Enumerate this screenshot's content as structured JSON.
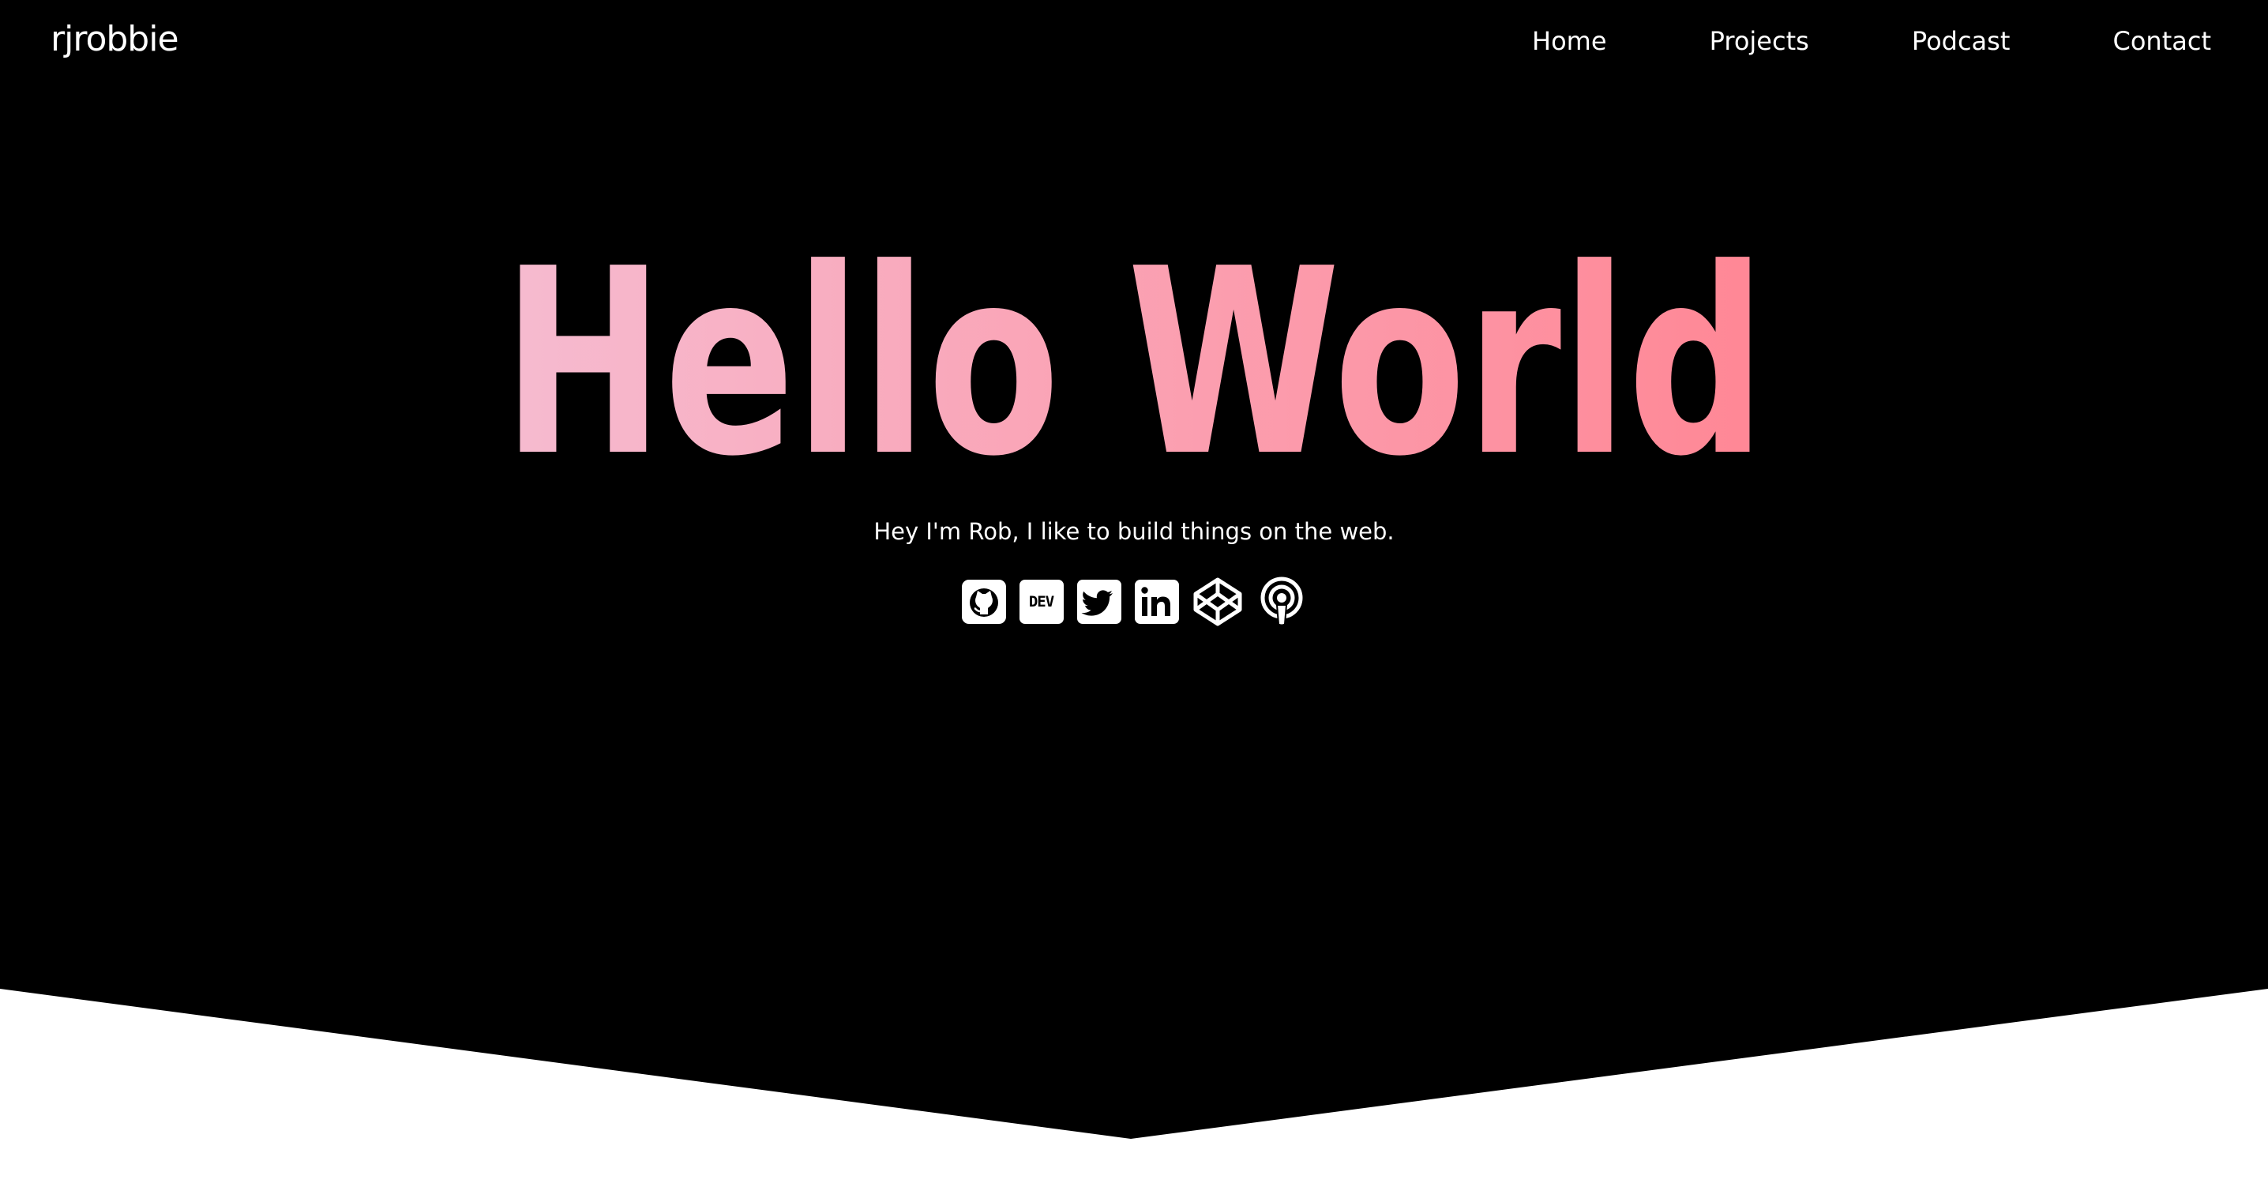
{
  "brand": {
    "name": "rjrobbie"
  },
  "nav": {
    "items": [
      {
        "label": "Home"
      },
      {
        "label": "Projects"
      },
      {
        "label": "Podcast"
      },
      {
        "label": "Contact"
      }
    ]
  },
  "hero": {
    "title": "Hello World",
    "tagline": "Hey I'm Rob, I like to build things on the web.",
    "gradient": {
      "start": "#F6BBD0",
      "end": "#FF8795"
    }
  },
  "social_links": [
    {
      "icon": "github-icon"
    },
    {
      "icon": "dev-icon",
      "text": "DEV"
    },
    {
      "icon": "twitter-icon"
    },
    {
      "icon": "linkedin-icon"
    },
    {
      "icon": "codepen-icon"
    },
    {
      "icon": "podcast-icon"
    }
  ],
  "colors": {
    "hero_background": "#000000",
    "page_background": "#FFFFFF",
    "text": "#FFFFFF"
  }
}
